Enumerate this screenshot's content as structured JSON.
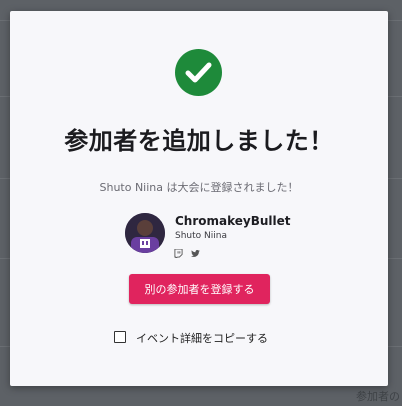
{
  "modal": {
    "title": "参加者を追加しました！",
    "message": "Shuto Niina は大会に登録されました！",
    "participant": {
      "display_name": "ChromakeyBullet",
      "real_name": "Shuto Niina",
      "social_icons": [
        "twitch-icon",
        "twitter-icon"
      ]
    },
    "register_button_label": "別の参加者を登録する",
    "copy_details_label": "イベント詳細をコピーする",
    "copy_details_checked": false
  },
  "background": {
    "corner_text": "参加者の"
  },
  "colors": {
    "success": "#1e8a3a",
    "accent": "#e0245e"
  }
}
